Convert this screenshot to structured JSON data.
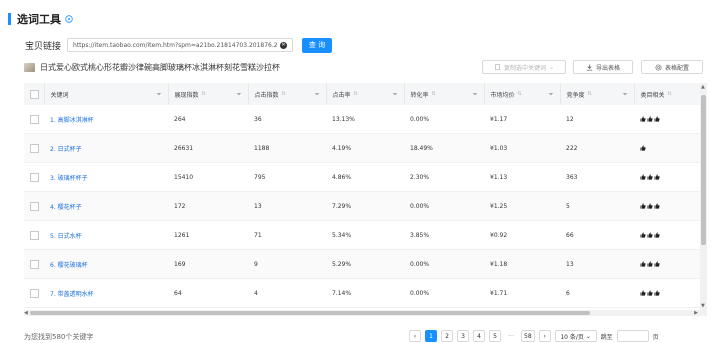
{
  "header": {
    "title": "选词工具"
  },
  "url_row": {
    "label": "宝贝链接",
    "value": "https://item.taobao.com/item.htm?spm=a21bo.21814703.201876.2",
    "query_label": "查 询"
  },
  "product": {
    "name": "日式爱心欧式桃心形花瓣沙律碗高脚玻璃杯冰淇淋杯刻花雪糕沙拉杯"
  },
  "toolbar": {
    "copy_label": "复制选中关键词",
    "export_label": "导出表格",
    "config_label": "表格配置"
  },
  "table": {
    "columns": [
      "关键词",
      "展现指数",
      "点击指数",
      "点击率",
      "转化率",
      "市场均价",
      "竞争度",
      "类目相关"
    ],
    "rows": [
      {
        "keyword": "1. 高脚冰淇淋杯",
        "impressions": "264",
        "clicks": "36",
        "ctr": "13.13%",
        "cvr": "0.00%",
        "price": "¥1.17",
        "competition": "12",
        "relevance": 3
      },
      {
        "keyword": "2. 日式杯子",
        "impressions": "26631",
        "clicks": "1188",
        "ctr": "4.19%",
        "cvr": "18.49%",
        "price": "¥1.03",
        "competition": "222",
        "relevance": 1
      },
      {
        "keyword": "3. 玻璃杯杯子",
        "impressions": "15410",
        "clicks": "795",
        "ctr": "4.86%",
        "cvr": "2.30%",
        "price": "¥1.13",
        "competition": "363",
        "relevance": 3
      },
      {
        "keyword": "4. 樱花杯子",
        "impressions": "172",
        "clicks": "13",
        "ctr": "7.29%",
        "cvr": "0.00%",
        "price": "¥1.25",
        "competition": "5",
        "relevance": 3
      },
      {
        "keyword": "5. 日式水杯",
        "impressions": "1261",
        "clicks": "71",
        "ctr": "5.34%",
        "cvr": "3.85%",
        "price": "¥0.92",
        "competition": "66",
        "relevance": 3
      },
      {
        "keyword": "6. 樱花玻璃杯",
        "impressions": "169",
        "clicks": "9",
        "ctr": "5.29%",
        "cvr": "0.00%",
        "price": "¥1.18",
        "competition": "13",
        "relevance": 3
      },
      {
        "keyword": "7. 带盖透明水杯",
        "impressions": "64",
        "clicks": "4",
        "ctr": "7.14%",
        "cvr": "0.00%",
        "price": "¥1.71",
        "competition": "6",
        "relevance": 3
      }
    ]
  },
  "footer": {
    "count_text": "为您找到580个关键字",
    "pages": [
      "1",
      "2",
      "3",
      "4",
      "5"
    ],
    "ellipsis": "···",
    "last_page": "58",
    "page_size": "10 条/页",
    "jump_label": "跳至",
    "page_suffix": "页"
  },
  "colors": {
    "accent": "#1890ff",
    "link": "#1a6fd6"
  },
  "icons": [
    "help-icon",
    "clear-icon",
    "product-thumbnail",
    "copy-icon",
    "export-icon",
    "settings-icon",
    "sort-icon",
    "filter-icon",
    "thumbs-up-icon"
  ]
}
